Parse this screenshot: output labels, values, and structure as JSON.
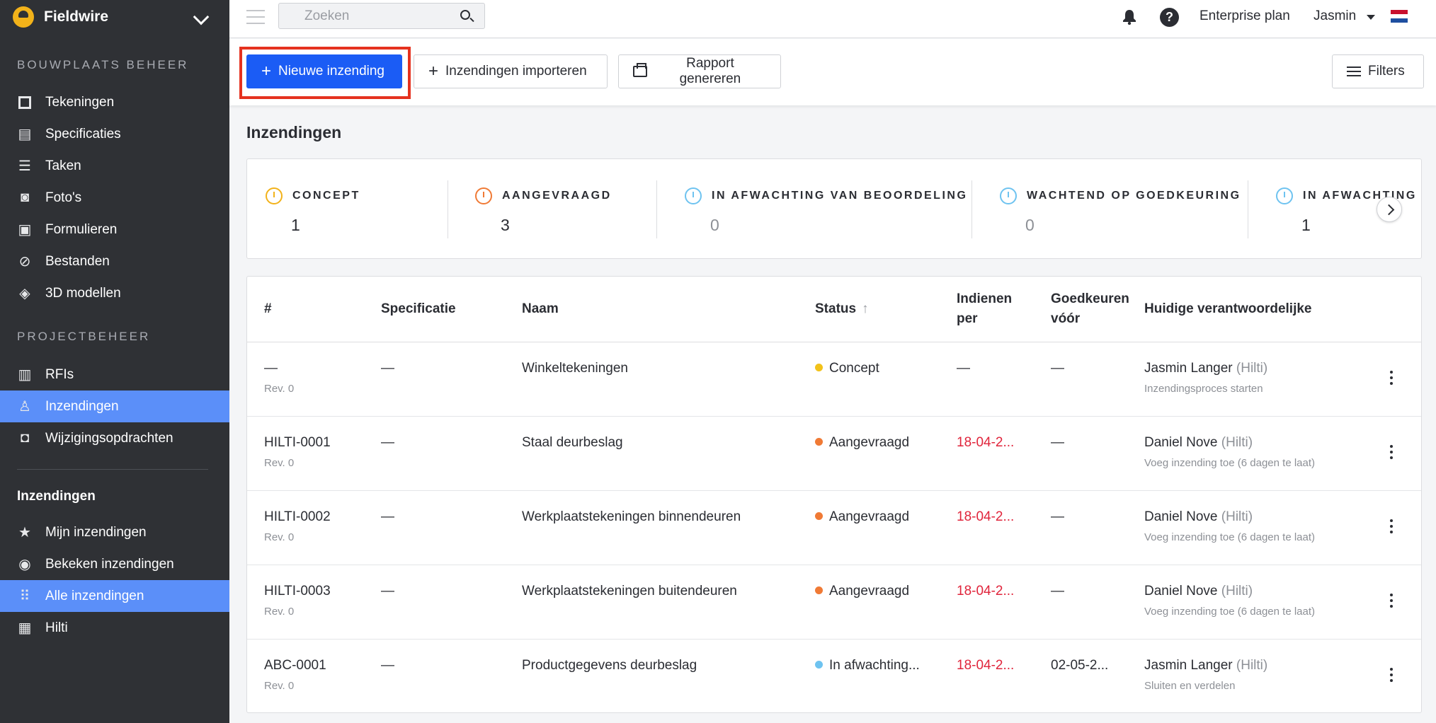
{
  "app": {
    "name": "Fieldwire"
  },
  "sidebar": {
    "section1_title": "BOUWPLAATS BEHEER",
    "section1_items": [
      {
        "label": "Tekeningen",
        "icon": "drawings-icon"
      },
      {
        "label": "Specificaties",
        "icon": "specifications-icon"
      },
      {
        "label": "Taken",
        "icon": "tasks-icon"
      },
      {
        "label": "Foto's",
        "icon": "camera-icon"
      },
      {
        "label": "Formulieren",
        "icon": "forms-icon"
      },
      {
        "label": "Bestanden",
        "icon": "paperclip-icon"
      },
      {
        "label": "3D modellen",
        "icon": "cube-icon"
      }
    ],
    "section2_title": "PROJECTBEHEER",
    "section2_items": [
      {
        "label": "RFIs",
        "icon": "rfi-icon"
      },
      {
        "label": "Inzendingen",
        "icon": "submittals-icon",
        "active": true
      },
      {
        "label": "Wijzigingsopdrachten",
        "icon": "change-orders-icon"
      }
    ],
    "sub_heading": "Inzendingen",
    "sub_items": [
      {
        "label": "Mijn inzendingen",
        "icon": "star-icon"
      },
      {
        "label": "Bekeken inzendingen",
        "icon": "eye-icon"
      },
      {
        "label": "Alle inzendingen",
        "icon": "grid-icon",
        "active": true
      },
      {
        "label": "Hilti",
        "icon": "briefcase-icon"
      }
    ]
  },
  "topbar": {
    "search_placeholder": "Zoeken",
    "plan": "Enterprise plan",
    "user": "Jasmin"
  },
  "toolbar": {
    "new_label": "Nieuwe inzending",
    "import_label": "Inzendingen importeren",
    "report_label": "Rapport genereren",
    "filters_label": "Filters"
  },
  "page_title": "Inzendingen",
  "status_cards": [
    {
      "label": "CONCEPT",
      "count": "1",
      "color": "#f2b21a"
    },
    {
      "label": "AANGEVRAAGD",
      "count": "3",
      "color": "#f07a35"
    },
    {
      "label": "IN AFWACHTING VAN BEOORDELING",
      "count": "0",
      "color": "#6ec3f0"
    },
    {
      "label": "WACHTEND OP GOEDKEURING",
      "count": "0",
      "color": "#6ec3f0"
    },
    {
      "label": "IN AFWACHTING V",
      "count": "1",
      "color": "#6ec3f0"
    }
  ],
  "table": {
    "headers": {
      "num": "#",
      "spec": "Specificatie",
      "name": "Naam",
      "status": "Status",
      "submit_by_1": "Indienen",
      "submit_by_2": "per",
      "approve_before_1": "Goedkeuren",
      "approve_before_2": "vóór",
      "owner": "Huidige verantwoordelijke"
    },
    "rows": [
      {
        "num": "—",
        "rev": "Rev. 0",
        "spec": "—",
        "name": "Winkeltekeningen",
        "status": "Concept",
        "status_color": "#f2c21a",
        "submit_by": "—",
        "approve_before": "—",
        "owner": "Jasmin Langer",
        "company": "(Hilti)",
        "action": "Inzendingsproces starten"
      },
      {
        "num": "HILTI-0001",
        "rev": "Rev. 0",
        "spec": "—",
        "name": "Staal deurbeslag",
        "status": "Aangevraagd",
        "status_color": "#f07a35",
        "submit_by": "18-04-2...",
        "approve_before": "—",
        "owner": "Daniel Nove",
        "company": "(Hilti)",
        "action": "Voeg inzending toe (6 dagen te laat)"
      },
      {
        "num": "HILTI-0002",
        "rev": "Rev. 0",
        "spec": "—",
        "name": "Werkplaatstekeningen binnendeuren",
        "status": "Aangevraagd",
        "status_color": "#f07a35",
        "submit_by": "18-04-2...",
        "approve_before": "—",
        "owner": "Daniel Nove",
        "company": "(Hilti)",
        "action": "Voeg inzending toe (6 dagen te laat)"
      },
      {
        "num": "HILTI-0003",
        "rev": "Rev. 0",
        "spec": "—",
        "name": "Werkplaatstekeningen buitendeuren",
        "status": "Aangevraagd",
        "status_color": "#f07a35",
        "submit_by": "18-04-2...",
        "approve_before": "—",
        "owner": "Daniel Nove",
        "company": "(Hilti)",
        "action": "Voeg inzending toe (6 dagen te laat)"
      },
      {
        "num": "ABC-0001",
        "rev": "Rev. 0",
        "spec": "—",
        "name": "Productgegevens deurbeslag",
        "status": "In afwachting...",
        "status_color": "#6ec3f0",
        "submit_by": "18-04-2...",
        "approve_before": "02-05-2...",
        "owner": "Jasmin Langer",
        "company": "(Hilti)",
        "action": "Sluiten en verdelen"
      }
    ]
  }
}
